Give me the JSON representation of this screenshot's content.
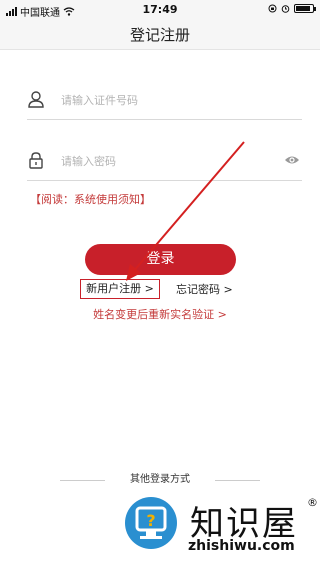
{
  "status_bar": {
    "carrier": "中国联通",
    "time": "17:49",
    "battery_level": 0.9
  },
  "nav": {
    "title": "登记注册"
  },
  "form": {
    "id_placeholder": "请输入证件号码",
    "password_placeholder": "请输入密码",
    "notice": "【阅读：系统使用须知】",
    "login_label": "登录",
    "register_label": "新用户注册 >",
    "forgot_label": "忘记密码 >",
    "name_change_label": "姓名变更后重新实名验证 >"
  },
  "other_login": {
    "label": "其他登录方式"
  },
  "watermark": {
    "name": "知识屋",
    "url": "zhishiwu.com"
  },
  "colors": {
    "accent": "#c8202a",
    "notice_text": "#c43a3a"
  }
}
